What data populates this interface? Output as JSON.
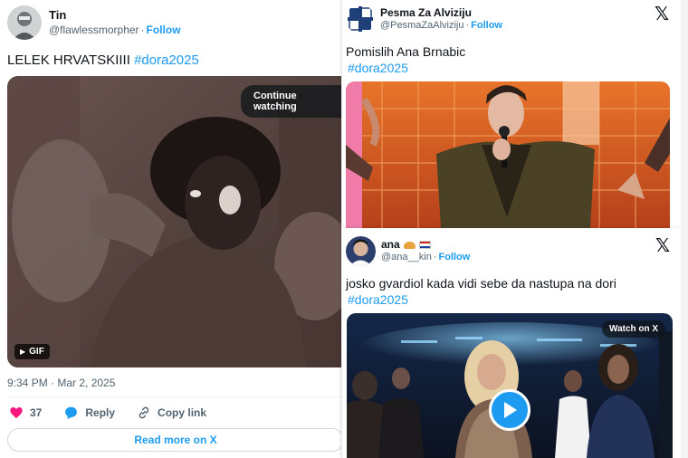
{
  "tweets": [
    {
      "display_name": "Tin",
      "handle": "@flawlessmorpher",
      "follow_label": "Follow",
      "text": "LELEK HRVATSKIIII",
      "hashtag": "#dora2025",
      "media_type": "GIF",
      "continue_label": "Continue watching",
      "timestamp": "9:34 PM · Mar 2, 2025",
      "likes": "37",
      "reply_label": "Reply",
      "copy_label": "Copy link",
      "read_more_label": "Read more on X"
    },
    {
      "display_name": "Pesma Za Alviziju",
      "handle": "@PesmaZaAlviziju",
      "follow_label": "Follow",
      "text": "Pomislih Ana Brnabic",
      "hashtag": "#dora2025"
    },
    {
      "display_name": "ana",
      "handle": "@ana__kin",
      "follow_label": "Follow",
      "text": "josko gvardiol kada vidi sebe da nastupa na dori",
      "hashtag": "#dora2025",
      "watch_label": "Watch on X"
    }
  ],
  "icons": [
    "x-logo-icon",
    "heart-icon",
    "reply-bubble-icon",
    "link-icon",
    "play-icon",
    "gif-play-icon",
    "croatia-flag-icon"
  ],
  "colors": {
    "accent": "#1d9bf0",
    "like": "#f91880",
    "text": "#0f1419",
    "muted": "#536471"
  }
}
